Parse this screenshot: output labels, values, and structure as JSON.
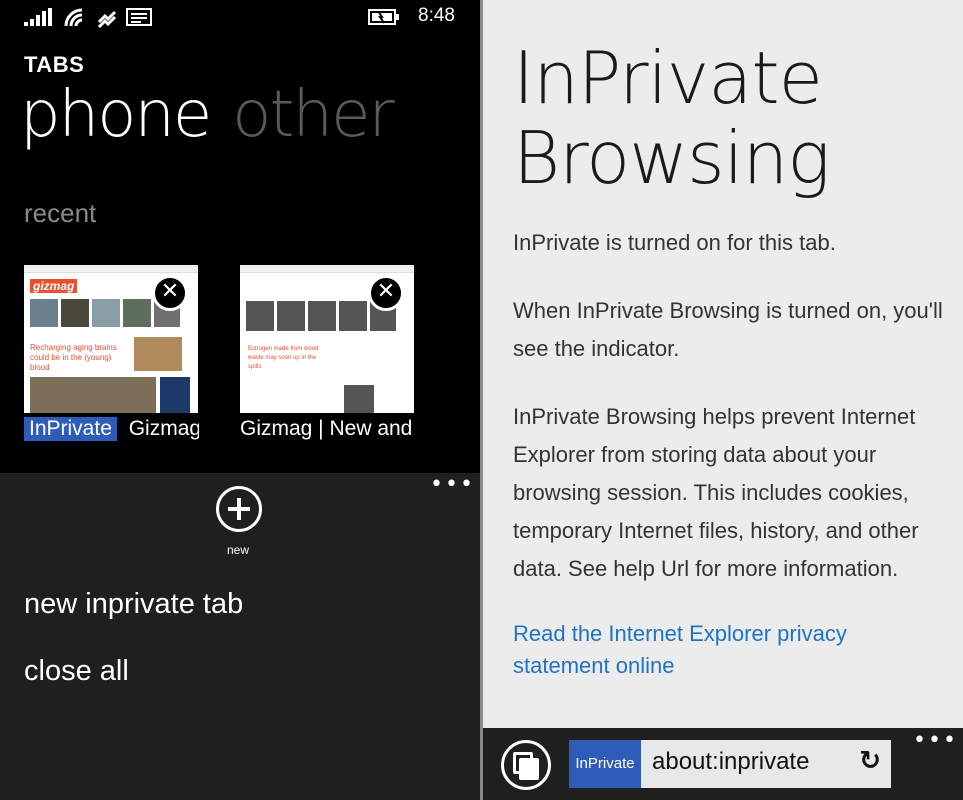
{
  "status_bar": {
    "time": "8:48",
    "icons": [
      "signal-icon",
      "wifi-icon",
      "data-sync-icon",
      "message-icon",
      "battery-charging-icon"
    ]
  },
  "tabs_page": {
    "header": "TABS",
    "pivots": [
      {
        "label": "phone",
        "active": true
      },
      {
        "label": "other",
        "active": false
      }
    ],
    "section": "recent",
    "tabs": [
      {
        "inprivate_badge": "InPrivate",
        "title": "Gizmag"
      },
      {
        "title": "Gizmag | New and I"
      }
    ],
    "thumb_texts": {
      "logo": "gizmag",
      "headline": "Recharging aging brains could be in the (young) blood",
      "preview2_headline": "Estrogen made from wood waste may soon up in the spills"
    },
    "appbar": {
      "new_label": "new",
      "menu_items": [
        "new inprivate tab",
        "close all"
      ],
      "more_label": "•••"
    }
  },
  "inprivate_page": {
    "title": "InPrivate Browsing",
    "paragraphs": [
      "InPrivate is turned on for this tab.",
      "When InPrivate Browsing is turned on, you'll see the indicator.",
      "InPrivate Browsing helps prevent Internet Explorer from storing data about your browsing session. This includes cookies, temporary Internet files, history, and other data. See help Url for more information."
    ],
    "link": "Read the Internet Explorer privacy statement online",
    "address_bar": {
      "badge": "InPrivate",
      "url": "about:inprivate",
      "refresh_symbol": "↻",
      "more_label": "•••"
    }
  },
  "colors": {
    "accent_blue": "#2e5cb8",
    "link_blue": "#1f73c2",
    "appbar_bg": "#1f1f1f",
    "page_bg": "#ececec"
  }
}
